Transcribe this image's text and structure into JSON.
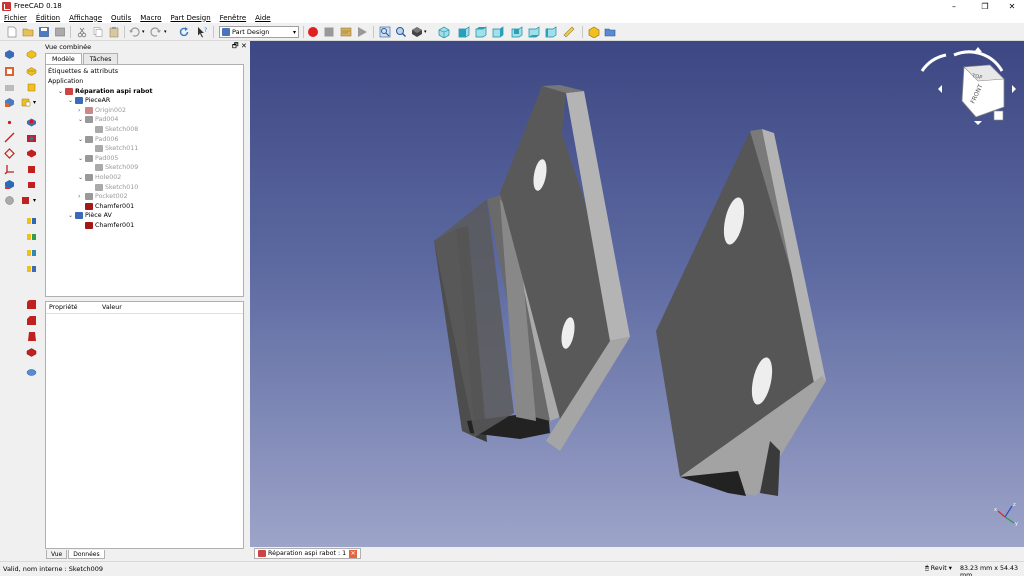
{
  "window": {
    "title": "FreeCAD 0.18",
    "minimize_glyph": "–",
    "maximize_glyph": "❐",
    "close_glyph": "✕"
  },
  "menu": [
    "Fichier",
    "Édition",
    "Affichage",
    "Outils",
    "Macro",
    "Part Design",
    "Fenêtre",
    "Aide"
  ],
  "toolbar": {
    "workbench_value": "Part Design"
  },
  "combo_view": {
    "title": "Vue combinée",
    "tabs": [
      "Modèle",
      "Tâches"
    ],
    "tree_caption": "Étiquettes & attributs",
    "tree": [
      {
        "label": "Application",
        "depth": 0,
        "arrow": "",
        "style": "normal",
        "icon": "none"
      },
      {
        "label": "Réparation aspi rabot",
        "depth": 1,
        "arrow": "⌄",
        "style": "bold",
        "icon": "document-icon"
      },
      {
        "label": "PieceAR",
        "depth": 2,
        "arrow": "⌄",
        "style": "normal",
        "icon": "body-icon"
      },
      {
        "label": "Origin002",
        "depth": 3,
        "arrow": "›",
        "style": "dim",
        "icon": "origin-icon"
      },
      {
        "label": "Pad004",
        "depth": 3,
        "arrow": "⌄",
        "style": "dim",
        "icon": "pad-icon"
      },
      {
        "label": "Sketch008",
        "depth": 4,
        "arrow": "",
        "style": "dim",
        "icon": "sketch-icon"
      },
      {
        "label": "Pad006",
        "depth": 3,
        "arrow": "⌄",
        "style": "dim",
        "icon": "pad-icon"
      },
      {
        "label": "Sketch011",
        "depth": 4,
        "arrow": "",
        "style": "dim",
        "icon": "sketch-icon"
      },
      {
        "label": "Pad005",
        "depth": 3,
        "arrow": "⌄",
        "style": "dim",
        "icon": "pad-icon"
      },
      {
        "label": "Sketch009",
        "depth": 4,
        "arrow": "",
        "style": "dim",
        "icon": "sketch-icon"
      },
      {
        "label": "Hole002",
        "depth": 3,
        "arrow": "⌄",
        "style": "dim",
        "icon": "hole-icon"
      },
      {
        "label": "Sketch010",
        "depth": 4,
        "arrow": "",
        "style": "dim",
        "icon": "sketch-icon"
      },
      {
        "label": "Pocket002",
        "depth": 3,
        "arrow": "›",
        "style": "dim",
        "icon": "pocket-icon"
      },
      {
        "label": "Chamfer001",
        "depth": 3,
        "arrow": "",
        "style": "normal",
        "icon": "chamfer-icon"
      },
      {
        "label": "Pièce AV",
        "depth": 2,
        "arrow": "⌄",
        "style": "normal",
        "icon": "body-icon"
      },
      {
        "label": "Chamfer001",
        "depth": 3,
        "arrow": "",
        "style": "normal",
        "icon": "chamfer-icon"
      }
    ],
    "property_headers": [
      "Propriété",
      "Valeur"
    ],
    "bottom_tabs": [
      "Vue",
      "Données"
    ]
  },
  "view3d": {
    "navcube_face": "FRONT",
    "navcube_face_top": "TOP",
    "axis_labels": [
      "x",
      "y",
      "z"
    ]
  },
  "document_tab": {
    "label": "Réparation aspi rabot : 1"
  },
  "status": {
    "message": "Valid, nom interne : Sketch009",
    "nav_style": "Revit",
    "dimensions": "83.23 mm x 54.43 mm"
  },
  "colors": {
    "view_top": "#3d4783",
    "view_bottom": "#9da4c9",
    "part_face": "#5a5a5a",
    "part_side": "#b5b5b5",
    "record": "#e02020"
  }
}
